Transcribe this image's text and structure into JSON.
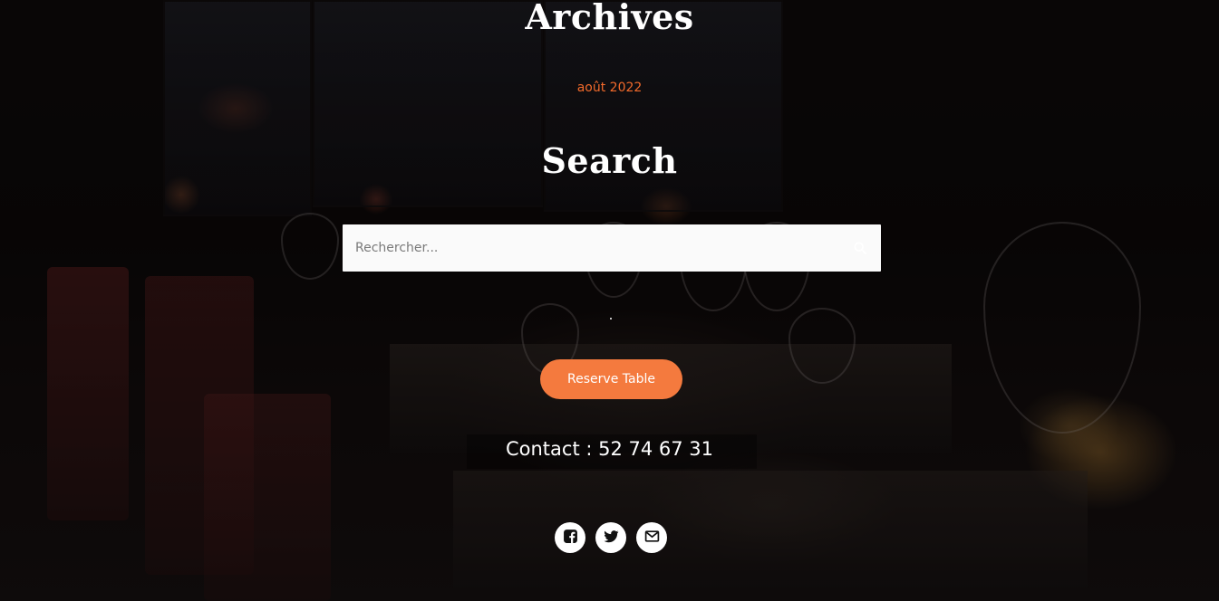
{
  "archives": {
    "title": "Archives",
    "items": [
      {
        "label": "août 2022"
      }
    ]
  },
  "search": {
    "title": "Search",
    "placeholder": "Rechercher...",
    "value": ""
  },
  "cta": {
    "reserve_label": "Reserve Table"
  },
  "contact": {
    "text": "Contact : 52 74 67 31"
  },
  "social": [
    {
      "icon": "facebook-icon"
    },
    {
      "icon": "twitter-icon"
    },
    {
      "icon": "email-icon"
    }
  ],
  "colors": {
    "accent": "#f47a3e",
    "link": "#f26a2b",
    "text": "#ffffff",
    "input_bg": "#fafafa"
  }
}
